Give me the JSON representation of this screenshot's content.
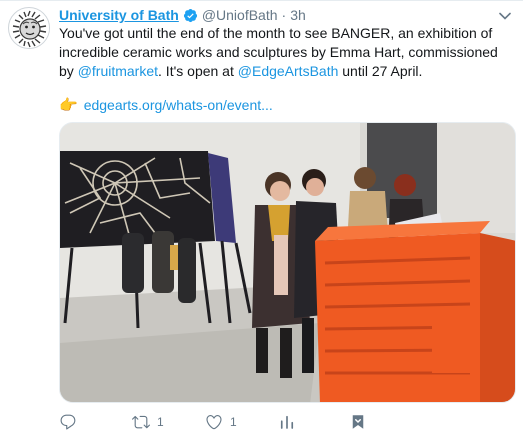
{
  "account": {
    "name": "University of Bath",
    "handle": "@UniofBath",
    "separator": "·",
    "time": "3h"
  },
  "tweet": {
    "part1": "You've got until the end of the month to see BANGER, an exhibition of incredible ceramic works and sculptures by Emma Hart, commissioned by ",
    "mention1": "@fruitmarket",
    "part2": ". It's open at ",
    "mention2": "@EdgeArtsBath",
    "part3": " until 27 April.",
    "hand": "👉",
    "link": "edgearts.org/whats-on/event..."
  },
  "actions": {
    "reply_count": "",
    "retweet_count": "1",
    "like_count": "1"
  },
  "icons": {
    "verified": "verified-badge-icon",
    "caret": "chevron-down-icon",
    "reply": "reply-icon",
    "retweet": "retweet-icon",
    "like": "heart-icon",
    "analytics": "analytics-icon",
    "share": "share-icon"
  },
  "colors": {
    "link": "#1b95e0",
    "text": "#14171a",
    "muted": "#657786",
    "sculpture_orange": "#f05a23"
  }
}
